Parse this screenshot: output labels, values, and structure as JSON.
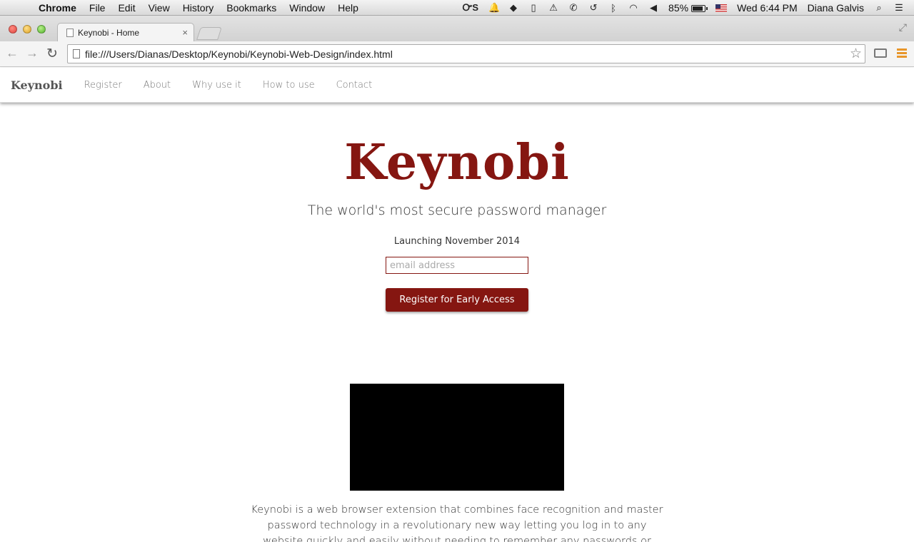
{
  "menubar": {
    "app_name": "Chrome",
    "menus": [
      "File",
      "Edit",
      "View",
      "History",
      "Bookmarks",
      "Window",
      "Help"
    ],
    "status": {
      "os_icon_text": "ᏅS",
      "battery_percent": "85%",
      "datetime": "Wed 6:44 PM",
      "user": "Diana Galvis"
    }
  },
  "browser": {
    "tab_title": "Keynobi - Home",
    "url": "file:///Users/Dianas/Desktop/Keynobi/Keynobi-Web-Design/index.html"
  },
  "site": {
    "nav": {
      "brand": "Keynobi",
      "links": [
        "Register",
        "About",
        "Why use it",
        "How to use",
        "Contact"
      ]
    },
    "hero": {
      "title": "Keynobi",
      "subtitle": "The world's most secure password manager",
      "launch_text": "Launching November 2014",
      "email_placeholder": "email address",
      "cta_label": "Register for Early Access"
    },
    "description": "Keynobi is a web browser extension that combines face recognition and master password technology in a revolutionary new way letting you log in to any website quickly and easily without needing to remember any passwords or usernames."
  },
  "colors": {
    "brand": "#851611"
  }
}
